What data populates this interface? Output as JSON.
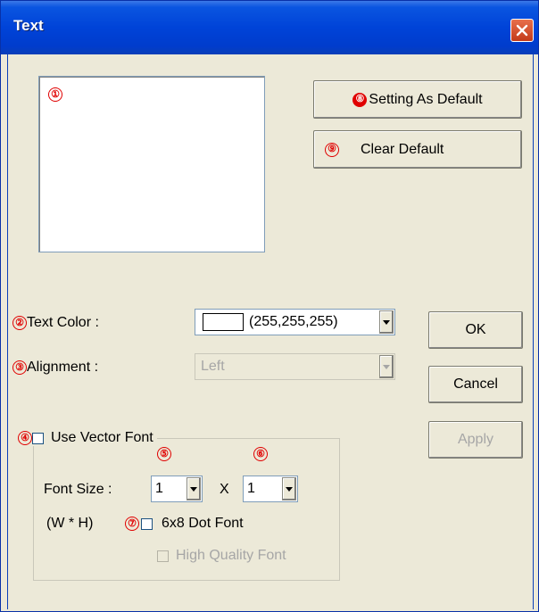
{
  "window": {
    "title": "Text"
  },
  "markers": {
    "m1": "①",
    "m2": "②",
    "m3": "③",
    "m4": "④",
    "m5": "⑤",
    "m6": "⑥",
    "m7": "⑦",
    "m8": "⑧",
    "m9": "⑨"
  },
  "buttons": {
    "set_default": "Setting As Default",
    "clear_default": "Clear Default",
    "ok": "OK",
    "cancel": "Cancel",
    "apply": "Apply"
  },
  "text_color": {
    "label": "Text Color :",
    "value": "(255,255,255)",
    "swatch_color": "#ffffff"
  },
  "alignment": {
    "label": "Alignment :",
    "value": "Left"
  },
  "vector_font": {
    "label": "Use Vector Font",
    "font_size_label": "Font Size :",
    "width_value": "1",
    "x_label": "X",
    "height_value": "1",
    "wh_label": "(W * H)",
    "dot_font_label": "6x8 Dot Font",
    "high_quality_label": "High Quality Font"
  },
  "colors": {
    "marker": "#e00000",
    "title_bar": "#0043d8",
    "dialog_bg": "#ece9d8"
  }
}
